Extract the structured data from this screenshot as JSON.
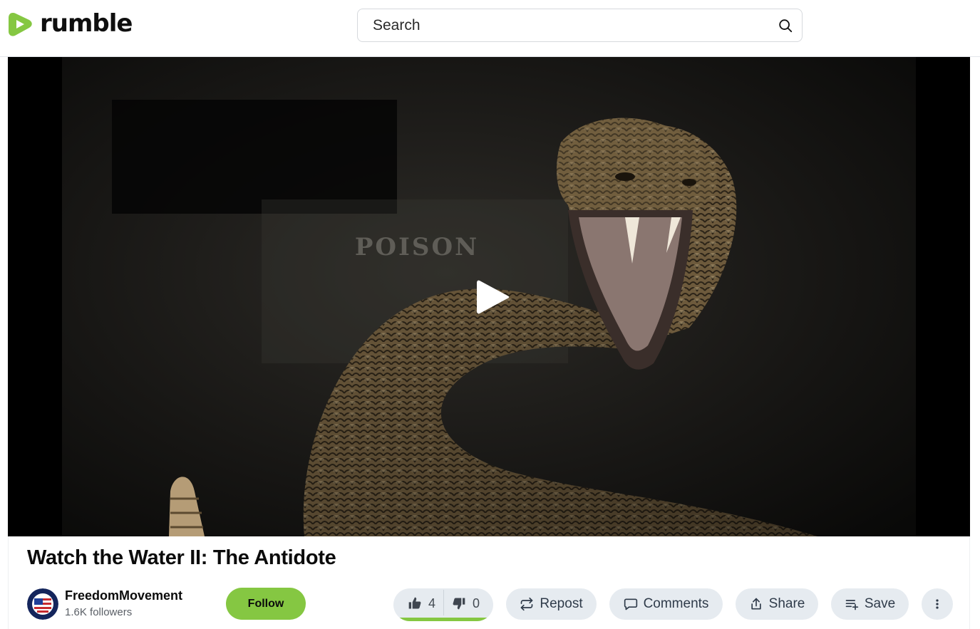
{
  "header": {
    "logo_text": "rumble",
    "search_placeholder": "Search"
  },
  "video": {
    "title": "Watch the Water II: The Antidote",
    "thumbnail_text": "POISON"
  },
  "channel": {
    "name": "FreedomMovement",
    "followers": "1.6K followers",
    "follow_label": "Follow"
  },
  "actions": {
    "likes": "4",
    "dislikes": "0",
    "like_ratio": 1.0,
    "repost_label": "Repost",
    "comments_label": "Comments",
    "share_label": "Share",
    "save_label": "Save"
  },
  "colors": {
    "brand_green": "#85c742",
    "pill_bg": "#e6ebf0",
    "pill_text": "#2f3b4a"
  }
}
